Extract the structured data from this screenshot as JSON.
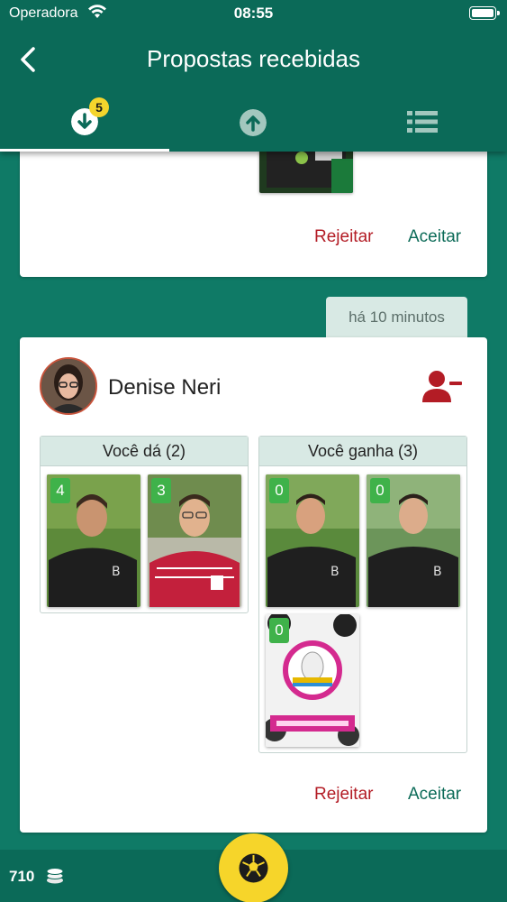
{
  "status_bar": {
    "carrier": "Operadora",
    "time": "08:55"
  },
  "header": {
    "title": "Propostas recebidas"
  },
  "tabs": [
    {
      "icon": "arrow-down-circle-icon",
      "badge": "5",
      "active": true
    },
    {
      "icon": "arrow-up-circle-icon",
      "active": false
    },
    {
      "icon": "list-icon",
      "active": false
    }
  ],
  "proposals": [
    {
      "reject_label": "Rejeitar",
      "accept_label": "Aceitar"
    },
    {
      "time_ago": "há 10 minutos",
      "user_name": "Denise Neri",
      "give": {
        "title": "Você dá (2)",
        "cards": [
          {
            "count": "4"
          },
          {
            "count": "3"
          }
        ]
      },
      "receive": {
        "title": "Você ganha (3)",
        "cards": [
          {
            "count": "0"
          },
          {
            "count": "0"
          },
          {
            "count": "0"
          }
        ]
      },
      "reject_label": "Rejeitar",
      "accept_label": "Aceitar"
    }
  ],
  "footer": {
    "coins": "710"
  },
  "colors": {
    "header": "#0b6a58",
    "background": "#0f7a66",
    "reject": "#b31c25",
    "accept": "#0c6b58",
    "badge": "#f5d52c",
    "count_badge": "#3fb24a"
  }
}
